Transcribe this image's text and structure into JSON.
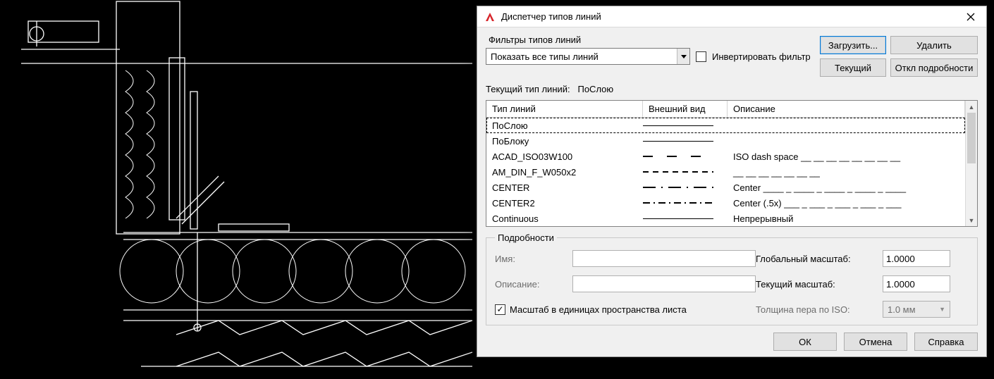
{
  "dialog": {
    "title": "Диспетчер типов линий",
    "filters": {
      "label": "Фильтры типов линий",
      "dropdown_value": "Показать все типы линий",
      "invert_label": "Инвертировать фильтр",
      "invert_checked": false
    },
    "buttons": {
      "load": "Загрузить...",
      "delete": "Удалить",
      "current": "Текущий",
      "hide_details": "Откл подробности"
    },
    "current": {
      "label": "Текущий тип линий:",
      "value": "ПоСлою"
    },
    "columns": {
      "name": "Тип линий",
      "appearance": "Внешний вид",
      "description": "Описание"
    },
    "rows": [
      {
        "name": "ПоСлою",
        "desc": "",
        "style": "solid",
        "selected": true
      },
      {
        "name": "ПоБлоку",
        "desc": "",
        "style": "solid"
      },
      {
        "name": "ACAD_ISO03W100",
        "desc": "ISO dash space __  __  __  __  __  __  __  __",
        "style": "isospace"
      },
      {
        "name": "AM_DIN_F_W050x2",
        "desc": "__ __ __ __ __ __ __",
        "style": "smalldash"
      },
      {
        "name": "CENTER",
        "desc": "Center ____ _ ____ _ ____ _ ____ _ ____",
        "style": "dashdot"
      },
      {
        "name": "CENTER2",
        "desc": "Center (.5x) ___ _ ___ _ ___ _ ___ _ ___",
        "style": "dashdot2"
      },
      {
        "name": "Continuous",
        "desc": "Непрерывный",
        "style": "solid"
      }
    ],
    "details": {
      "legend": "Подробности",
      "name_label": "Имя:",
      "name_value": "",
      "desc_label": "Описание:",
      "desc_value": "",
      "scale_units_label": "Масштаб в единицах пространства листа",
      "scale_units_checked": true,
      "global_scale_label": "Глобальный масштаб:",
      "global_scale_value": "1.0000",
      "current_scale_label": "Текущий масштаб:",
      "current_scale_value": "1.0000",
      "pen_label": "Толщина пера по ISO:",
      "pen_value": "1.0 мм"
    },
    "footer": {
      "ok": "ОК",
      "cancel": "Отмена",
      "help": "Справка"
    }
  }
}
